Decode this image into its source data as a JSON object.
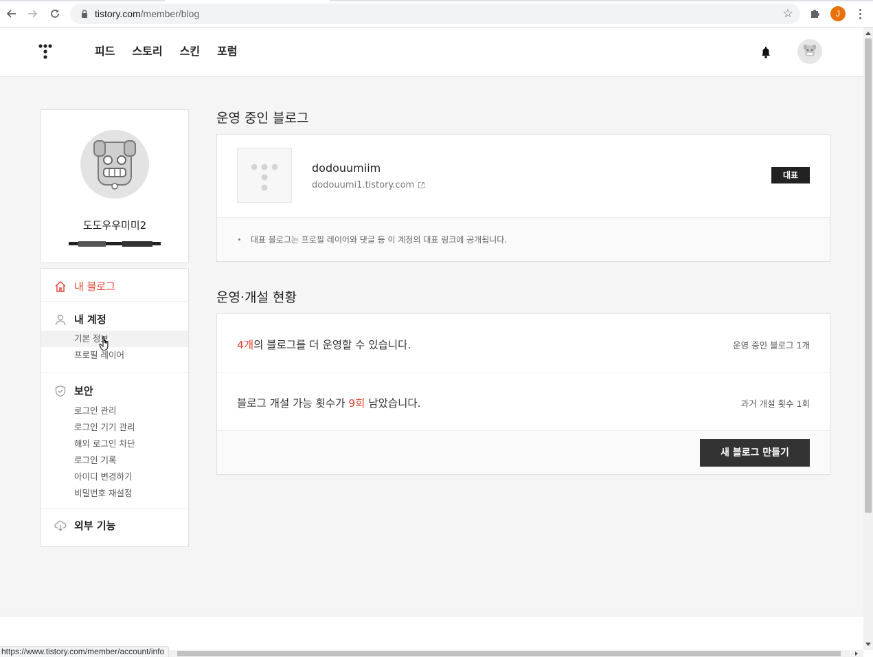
{
  "browser": {
    "url_host": "tistory.com",
    "url_path": "/member/blog",
    "profile_initial": "J",
    "status_url": "https://www.tistory.com/member/account/info"
  },
  "gnb": {
    "menu": [
      "피드",
      "스토리",
      "스킨",
      "포럼"
    ]
  },
  "profile": {
    "name": "도도우우미미2",
    "email": "██████@████████"
  },
  "sidebar": {
    "my_blog": "내 블로그",
    "my_account": {
      "label": "내 계정",
      "items": [
        "기본 정보",
        "프로필 레이어"
      ]
    },
    "security": {
      "label": "보안",
      "items": [
        "로그인 관리",
        "로그인 기기 관리",
        "해외 로그인 차단",
        "로그인 기록",
        "아이디 변경하기",
        "비밀번호 재설정"
      ]
    },
    "external": "외부 기능"
  },
  "blogs_section": {
    "title": "운영 중인 블로그",
    "blog": {
      "name": "dodouumiim",
      "url": "dodouumi1.tistory.com",
      "badge": "대표"
    },
    "note": "대표 블로그는 프로필 레이어와 댓글 등 이 계정의 대표 링크에 공개됩니다."
  },
  "status_section": {
    "title": "운영·개설 현황",
    "row1": {
      "highlight": "4개",
      "rest": "의 블로그를 더 운영할 수 있습니다.",
      "side": "운영 중인 블로그 1개"
    },
    "row2": {
      "pre": "블로그 개설 가능 횟수가 ",
      "highlight": "9회",
      "post": " 남았습니다.",
      "side": "과거 개설 횟수 1회"
    },
    "button": "새 블로그 만들기"
  },
  "colors": {
    "accent": "#e0402c",
    "dark": "#222222",
    "page_bg": "#f5f5f5"
  }
}
